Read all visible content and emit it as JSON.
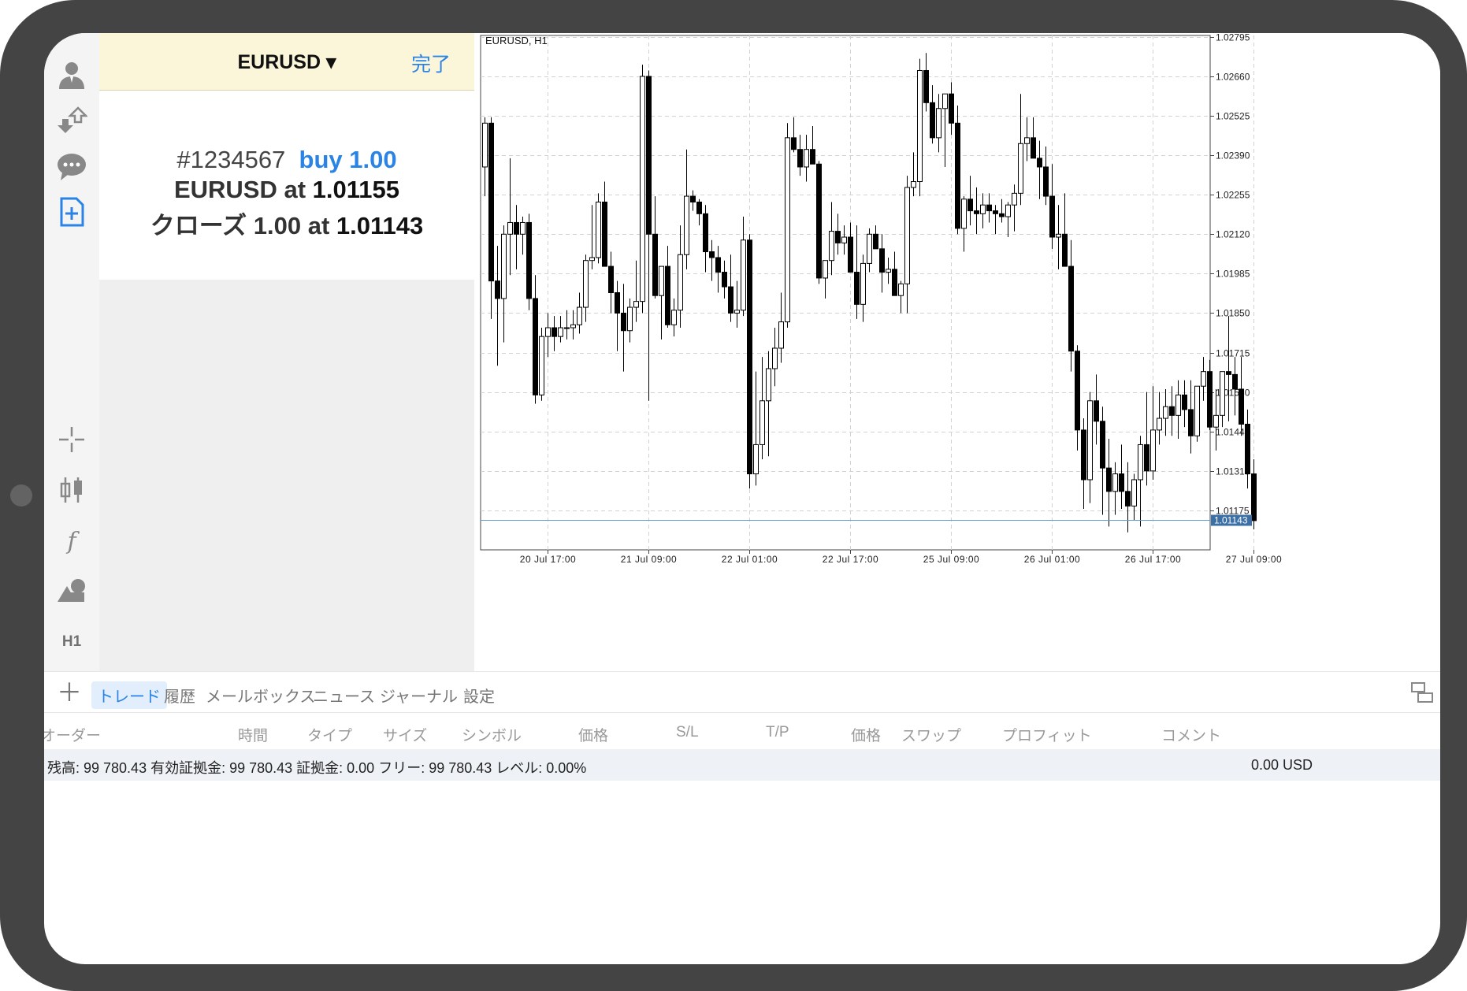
{
  "panel": {
    "symbol": "EURUSD ▾",
    "done": "完了",
    "ticket": "#1234567",
    "order": "buy 1.00",
    "line2_prefix": "EURUSD at ",
    "line2_price": "1.01155",
    "line3_prefix": "クローズ 1.00 at ",
    "line3_price": "1.01143"
  },
  "sidebar": {
    "icons": [
      "account-icon",
      "trade-transfer-icon",
      "chat-icon",
      "new-order-icon",
      "crosshair-icon",
      "candlestick-icon",
      "indicator-icon",
      "objects-icon"
    ],
    "timeframe": "H1"
  },
  "chart_data": {
    "type": "candlestick",
    "title": "EURUSD, H1",
    "ylim": [
      1.0104,
      1.028
    ],
    "y_ticks": [
      "1.02795",
      "1.02660",
      "1.02525",
      "1.02390",
      "1.02255",
      "1.02120",
      "1.01985",
      "1.01850",
      "1.01715",
      "1.01580",
      "1.01445",
      "1.01310",
      "1.01175"
    ],
    "y_tick_values": [
      1.02795,
      1.0266,
      1.02525,
      1.0239,
      1.02255,
      1.0212,
      1.01985,
      1.0185,
      1.01715,
      1.0158,
      1.01445,
      1.0131,
      1.01175
    ],
    "x_ticks": [
      "20 Jul 17:00",
      "21 Jul 09:00",
      "22 Jul 01:00",
      "22 Jul 17:00",
      "25 Jul 09:00",
      "26 Jul 01:00",
      "26 Jul 17:00",
      "27 Jul 09:00"
    ],
    "x_tick_bars": [
      10,
      26,
      42,
      58,
      74,
      90,
      106,
      122
    ],
    "grid": true,
    "current_price": 1.01143,
    "current_price_label": "1.01143",
    "colors": {
      "bull": "#ffffff",
      "bear": "#000000",
      "price_line": "#6a9cc9",
      "price_tag": "#3b6fa6"
    },
    "ohlc": [
      [
        1.0235,
        1.0252,
        1.0225,
        1.025
      ],
      [
        1.025,
        1.0252,
        1.0183,
        1.0196
      ],
      [
        1.0196,
        1.0208,
        1.0167,
        1.019
      ],
      [
        1.019,
        1.0215,
        1.0175,
        1.0212
      ],
      [
        1.0212,
        1.0238,
        1.0198,
        1.0216
      ],
      [
        1.0216,
        1.0222,
        1.02,
        1.0212
      ],
      [
        1.0212,
        1.0218,
        1.0205,
        1.0216
      ],
      [
        1.0216,
        1.0219,
        1.0186,
        1.019
      ],
      [
        1.019,
        1.0198,
        1.0154,
        1.0157
      ],
      [
        1.0157,
        1.018,
        1.0155,
        1.0177
      ],
      [
        1.0177,
        1.0185,
        1.017,
        1.018
      ],
      [
        1.018,
        1.0184,
        1.0172,
        1.0177
      ],
      [
        1.0177,
        1.0184,
        1.0175,
        1.018
      ],
      [
        1.018,
        1.0186,
        1.0176,
        1.018
      ],
      [
        1.018,
        1.0186,
        1.0176,
        1.0181
      ],
      [
        1.0181,
        1.0192,
        1.0178,
        1.0187
      ],
      [
        1.0187,
        1.0205,
        1.0182,
        1.0203
      ],
      [
        1.0203,
        1.0222,
        1.02,
        1.0204
      ],
      [
        1.0204,
        1.0226,
        1.0202,
        1.0223
      ],
      [
        1.0223,
        1.023,
        1.021,
        1.0201
      ],
      [
        1.0201,
        1.0206,
        1.0185,
        1.0192
      ],
      [
        1.0192,
        1.0196,
        1.0172,
        1.0185
      ],
      [
        1.0185,
        1.0195,
        1.0165,
        1.0179
      ],
      [
        1.0179,
        1.019,
        1.0175,
        1.0187
      ],
      [
        1.0187,
        1.0203,
        1.0182,
        1.0189
      ],
      [
        1.0189,
        1.027,
        1.0185,
        1.0266
      ],
      [
        1.0266,
        1.0268,
        1.0155,
        1.0212
      ],
      [
        1.0212,
        1.0225,
        1.019,
        1.0191
      ],
      [
        1.0191,
        1.02,
        1.0176,
        1.0201
      ],
      [
        1.0201,
        1.0208,
        1.018,
        1.0181
      ],
      [
        1.0181,
        1.019,
        1.0177,
        1.0186
      ],
      [
        1.0186,
        1.0215,
        1.018,
        1.0205
      ],
      [
        1.0205,
        1.0241,
        1.02,
        1.0225
      ],
      [
        1.0225,
        1.0227,
        1.022,
        1.0223
      ],
      [
        1.0223,
        1.0224,
        1.0215,
        1.0219
      ],
      [
        1.0219,
        1.0222,
        1.0199,
        1.0206
      ],
      [
        1.0206,
        1.021,
        1.0196,
        1.0204
      ],
      [
        1.0204,
        1.0208,
        1.0192,
        1.0199
      ],
      [
        1.0199,
        1.0203,
        1.019,
        1.0194
      ],
      [
        1.0194,
        1.0205,
        1.0182,
        1.0185
      ],
      [
        1.0185,
        1.0196,
        1.018,
        1.0186
      ],
      [
        1.0186,
        1.0218,
        1.0184,
        1.021
      ],
      [
        1.021,
        1.0212,
        1.0125,
        1.013
      ],
      [
        1.013,
        1.0165,
        1.0126,
        1.014
      ],
      [
        1.014,
        1.017,
        1.0135,
        1.0155
      ],
      [
        1.0155,
        1.0172,
        1.0136,
        1.0166
      ],
      [
        1.0166,
        1.018,
        1.016,
        1.0173
      ],
      [
        1.0173,
        1.0192,
        1.0168,
        1.0182
      ],
      [
        1.0182,
        1.025,
        1.018,
        1.0245
      ],
      [
        1.0245,
        1.0252,
        1.024,
        1.0241
      ],
      [
        1.0241,
        1.0246,
        1.0232,
        1.0235
      ],
      [
        1.0235,
        1.0246,
        1.023,
        1.0241
      ],
      [
        1.0241,
        1.0249,
        1.0238,
        1.0236
      ],
      [
        1.0236,
        1.0237,
        1.0195,
        1.0197
      ],
      [
        1.0197,
        1.0203,
        1.019,
        1.0203
      ],
      [
        1.0203,
        1.0223,
        1.0198,
        1.0213
      ],
      [
        1.0213,
        1.0219,
        1.0205,
        1.0209
      ],
      [
        1.0209,
        1.0215,
        1.0205,
        1.0211
      ],
      [
        1.0211,
        1.0216,
        1.0199,
        1.0199
      ],
      [
        1.0199,
        1.0215,
        1.0183,
        1.0188
      ],
      [
        1.0188,
        1.0205,
        1.0182,
        1.0202
      ],
      [
        1.0202,
        1.0214,
        1.0199,
        1.0212
      ],
      [
        1.0212,
        1.0215,
        1.0208,
        1.0207
      ],
      [
        1.0207,
        1.0212,
        1.0192,
        1.0199
      ],
      [
        1.0199,
        1.0204,
        1.0195,
        1.02
      ],
      [
        1.02,
        1.0206,
        1.0197,
        1.0191
      ],
      [
        1.0191,
        1.0196,
        1.0185,
        1.0195
      ],
      [
        1.0195,
        1.0232,
        1.0185,
        1.0228
      ],
      [
        1.0228,
        1.024,
        1.0225,
        1.023
      ],
      [
        1.023,
        1.0272,
        1.0225,
        1.0268
      ],
      [
        1.0268,
        1.0274,
        1.0254,
        1.0257
      ],
      [
        1.0257,
        1.0263,
        1.0243,
        1.0245
      ],
      [
        1.0245,
        1.026,
        1.024,
        1.0255
      ],
      [
        1.0255,
        1.026,
        1.0235,
        1.026
      ],
      [
        1.026,
        1.0264,
        1.0246,
        1.025
      ],
      [
        1.025,
        1.0256,
        1.0212,
        1.0214
      ],
      [
        1.0214,
        1.0225,
        1.0206,
        1.0224
      ],
      [
        1.0224,
        1.0232,
        1.0215,
        1.022
      ],
      [
        1.022,
        1.0228,
        1.0212,
        1.0219
      ],
      [
        1.0219,
        1.0226,
        1.0214,
        1.0222
      ],
      [
        1.0222,
        1.0226,
        1.0216,
        1.022
      ],
      [
        1.022,
        1.0222,
        1.0212,
        1.0219
      ],
      [
        1.0219,
        1.0224,
        1.0216,
        1.0218
      ],
      [
        1.0218,
        1.0223,
        1.0211,
        1.0222
      ],
      [
        1.0222,
        1.0229,
        1.0213,
        1.0226
      ],
      [
        1.0226,
        1.026,
        1.0222,
        1.0243
      ],
      [
        1.0243,
        1.0252,
        1.0237,
        1.0245
      ],
      [
        1.0245,
        1.0252,
        1.0238,
        1.0238
      ],
      [
        1.0238,
        1.0244,
        1.0224,
        1.0235
      ],
      [
        1.0235,
        1.0242,
        1.0222,
        1.0225
      ],
      [
        1.0225,
        1.0236,
        1.0207,
        1.0211
      ],
      [
        1.0211,
        1.0222,
        1.02,
        1.0212
      ],
      [
        1.0212,
        1.0226,
        1.0205,
        1.0201
      ],
      [
        1.0201,
        1.021,
        1.0165,
        1.0172
      ],
      [
        1.0172,
        1.0174,
        1.0138,
        1.0145
      ],
      [
        1.0145,
        1.0149,
        1.0118,
        1.0128
      ],
      [
        1.0128,
        1.0158,
        1.012,
        1.0155
      ],
      [
        1.0155,
        1.0164,
        1.014,
        1.0148
      ],
      [
        1.0148,
        1.0153,
        1.0116,
        1.0132
      ],
      [
        1.0132,
        1.0142,
        1.0112,
        1.0124
      ],
      [
        1.0124,
        1.0134,
        1.0116,
        1.013
      ],
      [
        1.013,
        1.014,
        1.0118,
        1.0124
      ],
      [
        1.0124,
        1.0134,
        1.011,
        1.0119
      ],
      [
        1.0119,
        1.013,
        1.0114,
        1.0128
      ],
      [
        1.0128,
        1.0143,
        1.0112,
        1.014
      ],
      [
        1.014,
        1.0158,
        1.0126,
        1.0131
      ],
      [
        1.0131,
        1.016,
        1.0128,
        1.0145
      ],
      [
        1.0145,
        1.0158,
        1.014,
        1.0149
      ],
      [
        1.0149,
        1.0159,
        1.0143,
        1.0153
      ],
      [
        1.0153,
        1.016,
        1.0143,
        1.015
      ],
      [
        1.015,
        1.0162,
        1.0142,
        1.0157
      ],
      [
        1.0157,
        1.0162,
        1.0146,
        1.0152
      ],
      [
        1.0152,
        1.0162,
        1.0137,
        1.0143
      ],
      [
        1.0143,
        1.016,
        1.0141,
        1.016
      ],
      [
        1.016,
        1.017,
        1.0155,
        1.0165
      ],
      [
        1.0165,
        1.0169,
        1.0145,
        1.0146
      ],
      [
        1.0146,
        1.0159,
        1.0138,
        1.015
      ],
      [
        1.015,
        1.0162,
        1.0146,
        1.0165
      ],
      [
        1.0165,
        1.0184,
        1.0148,
        1.0164
      ],
      [
        1.0164,
        1.017,
        1.015,
        1.0159
      ],
      [
        1.0159,
        1.017,
        1.0143,
        1.0147
      ],
      [
        1.0147,
        1.0152,
        1.0125,
        1.013
      ],
      [
        1.013,
        1.0135,
        1.0111,
        1.0114
      ]
    ]
  },
  "tabs": {
    "items": [
      "トレード",
      "履歴",
      "メールボックス",
      "ニュース",
      "ジャーナル",
      "設定"
    ],
    "active": 0
  },
  "columns": [
    "オーダー",
    "時間",
    "タイプ",
    "サイズ",
    "シンボル",
    "価格",
    "S/L",
    "T/P",
    "価格",
    "スワップ",
    "プロフィット",
    "コメント"
  ],
  "balance": {
    "summary": "残高: 99 780.43 有効証拠金: 99 780.43 証拠金: 0.00 フリー: 99 780.43 レベル: 0.00%",
    "profit": "0.00  USD"
  }
}
